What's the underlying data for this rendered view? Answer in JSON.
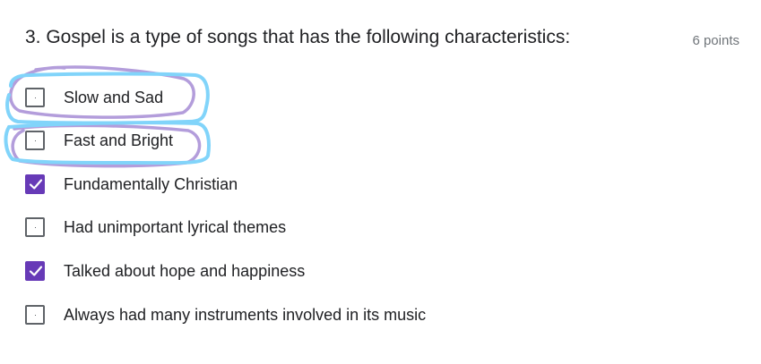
{
  "question": {
    "title": "3. Gospel is a type of songs that has the following characteristics:",
    "points": "6 points"
  },
  "options": [
    {
      "label": "Slow and Sad",
      "checked": false
    },
    {
      "label": "Fast and Bright",
      "checked": false
    },
    {
      "label": "Fundamentally Christian",
      "checked": true
    },
    {
      "label": "Had unimportant lyrical themes",
      "checked": false
    },
    {
      "label": "Talked about hope and happiness",
      "checked": true
    },
    {
      "label": "Always had many instruments involved in its music",
      "checked": false
    }
  ],
  "colors": {
    "accent": "#673ab7",
    "annotation_purple": "#b39ddb",
    "annotation_blue": "#81d4fa"
  },
  "icons": {
    "check": "checkmark-icon"
  }
}
